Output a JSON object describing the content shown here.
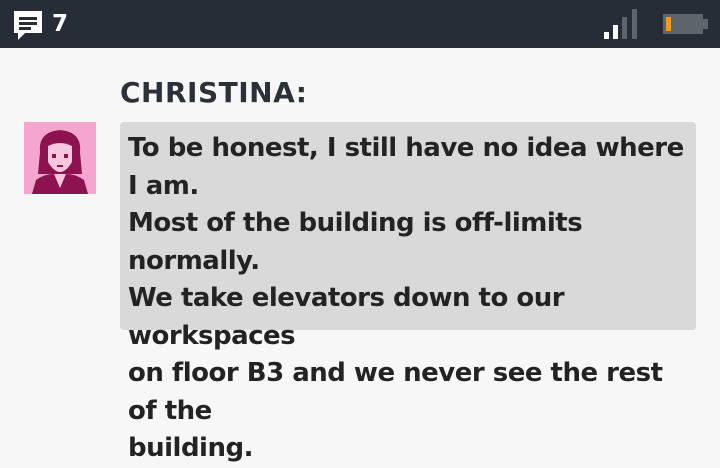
{
  "status_bar": {
    "message_icon": "chat-bubble-icon",
    "unread_count": "7",
    "signal_icon": "signal-strength-icon",
    "battery_icon": "battery-low-icon",
    "accent_color": "#f39c12"
  },
  "chat": {
    "speaker": "CHRISTINA:",
    "avatar_icon": "christina-portrait-avatar",
    "message": "To be honest, I still have no idea where I am.\nMost of the building is off-limits normally.\nWe take elevators down to our workspaces\non floor B3 and we never see the rest of the\nbuilding."
  }
}
